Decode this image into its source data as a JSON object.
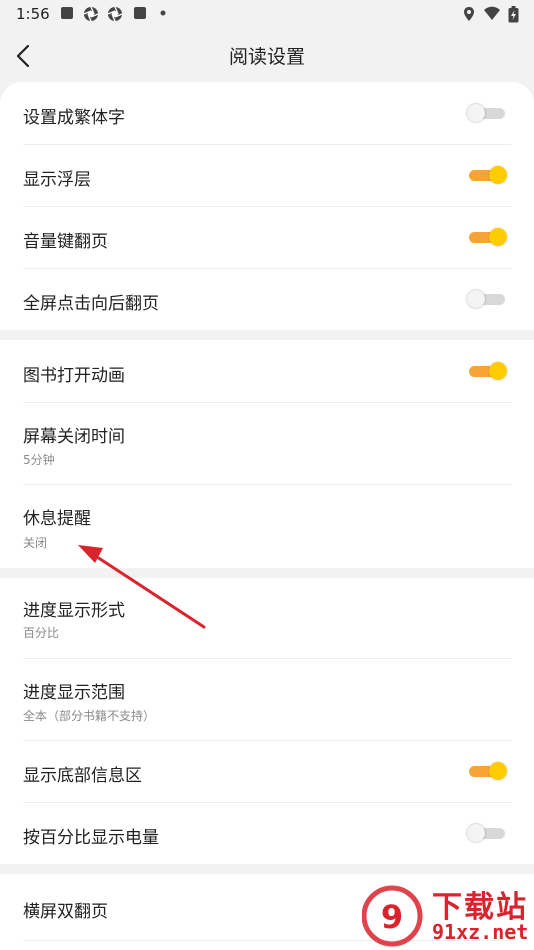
{
  "status": {
    "time": "1:56"
  },
  "header": {
    "title": "阅读设置"
  },
  "settings": [
    {
      "label": "设置成繁体字",
      "toggle": "off"
    },
    {
      "label": "显示浮层",
      "toggle": "on"
    },
    {
      "label": "音量键翻页",
      "toggle": "on"
    },
    {
      "label": "全屏点击向后翻页",
      "toggle": "off"
    },
    {
      "label": "图书打开动画",
      "toggle": "on"
    },
    {
      "label": "屏幕关闭时间",
      "sub": "5分钟"
    },
    {
      "label": "休息提醒",
      "sub": "关闭"
    },
    {
      "label": "进度显示形式",
      "sub": "百分比"
    },
    {
      "label": "进度显示范围",
      "sub": "全本（部分书籍不支持）"
    },
    {
      "label": "显示底部信息区",
      "toggle": "on"
    },
    {
      "label": "按百分比显示电量",
      "toggle": "off"
    },
    {
      "label": "横屏双翻页"
    }
  ],
  "watermark": {
    "brand": "下载站",
    "domain": "91xz.net"
  },
  "colors": {
    "accent": "#ffcc00",
    "track_on": "#f7a335",
    "annotation_arrow": "#d9232d"
  }
}
